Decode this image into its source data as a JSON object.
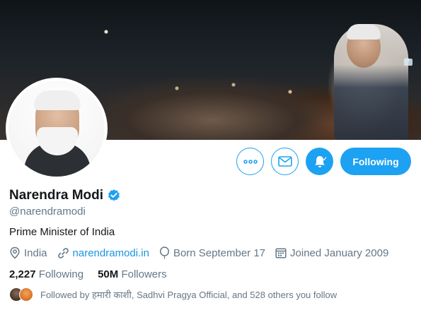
{
  "profile": {
    "display_name": "Narendra Modi",
    "handle": "@narendramodi",
    "bio": "Prime Minister of India",
    "verified": true
  },
  "meta": {
    "location": "India",
    "website": "narendramodi.in",
    "birthday": "Born September 17",
    "joined": "Joined January 2009"
  },
  "stats": {
    "following_count": "2,227",
    "following_label": "Following",
    "followers_count": "50M",
    "followers_label": "Followers"
  },
  "followed_by": {
    "text": "Followed by हमारी काशी, Sadhvi Pragya Official, and 528 others you follow"
  },
  "actions": {
    "following_label": "Following",
    "more_icon": "more-icon",
    "message_icon": "envelope-icon",
    "notify_icon": "bell-icon"
  },
  "colors": {
    "accent": "#1da1f2",
    "link": "#1b95e0",
    "secondary_text": "#657786",
    "primary_text": "#14171a"
  }
}
